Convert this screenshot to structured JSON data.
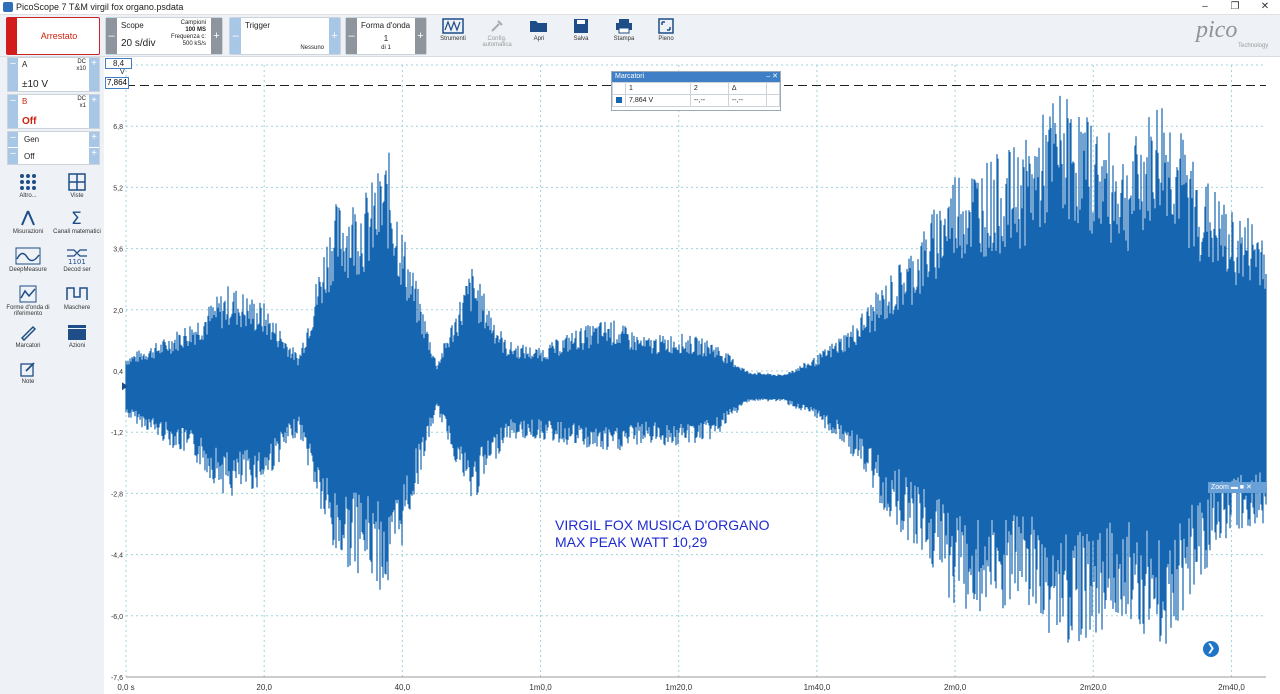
{
  "window": {
    "title": "PicoScope 7 T&M virgil fox organo.psdata"
  },
  "toolbar": {
    "run_status": "Arrestato",
    "scope": {
      "label": "Scope",
      "timebase": "20 s/div",
      "samples_label": "Campioni",
      "samples": "100 MS",
      "freq_label": "Frequenza c:",
      "freq": "500 kS/s"
    },
    "trigger": {
      "label": "Trigger",
      "mode": "Nessuno"
    },
    "waveform": {
      "label": "Forma d'onda",
      "current": "1",
      "of": "di 1"
    },
    "tools": [
      {
        "label": "Strumenti",
        "icon": "instruments-icon"
      },
      {
        "label": "Config. automatica",
        "icon": "auto-setup-icon"
      },
      {
        "label": "Apri",
        "icon": "folder-open-icon"
      },
      {
        "label": "Salva",
        "icon": "save-icon"
      },
      {
        "label": "Stampa",
        "icon": "print-icon"
      },
      {
        "label": "Pieno",
        "icon": "fullscreen-icon"
      }
    ],
    "logo": {
      "word": "pico",
      "sub": "Technology"
    }
  },
  "channels": {
    "a": {
      "name": "A",
      "coupling": "DC",
      "probe": "x10",
      "range": "±10 V"
    },
    "b": {
      "name": "B",
      "coupling": "DC",
      "probe": "x1",
      "range": "Off"
    },
    "gen": {
      "label": "Gen",
      "state": "Off"
    }
  },
  "side_tools": [
    {
      "label": "Altro...",
      "icon": "more-dots-icon"
    },
    {
      "label": "Viste",
      "icon": "views-grid-icon"
    },
    {
      "label": "Misurazioni",
      "icon": "compass-icon"
    },
    {
      "label": "Canali matematici",
      "icon": "sigma-icon"
    },
    {
      "label": "DeepMeasure",
      "icon": "deepmeasure-icon"
    },
    {
      "label": "Decod ser",
      "icon": "serial-decode-icon"
    },
    {
      "label": "Forme d'onda di riferimento",
      "icon": "reference-waveform-icon"
    },
    {
      "label": "Maschere",
      "icon": "masks-icon"
    },
    {
      "label": "Marcatori",
      "icon": "pencil-icon"
    },
    {
      "label": "Azioni",
      "icon": "clapper-icon"
    },
    {
      "label": "Note",
      "icon": "note-icon"
    }
  ],
  "plot": {
    "y_unit": "V",
    "y_ticks": [
      "8,4",
      "6,8",
      "5,2",
      "3,6",
      "2,0",
      "0,4",
      "-1,2",
      "-2,8",
      "-4,4",
      "-6,0",
      "-7,6"
    ],
    "x_ticks": [
      "0,0 s",
      "20,0",
      "40,0",
      "1m0,0",
      "1m20,0",
      "1m40,0",
      "2m0,0",
      "2m20,0",
      "2m40,0"
    ],
    "marker_value": "7,864",
    "markers_window": {
      "title": "Marcatori",
      "headers": [
        "1",
        "2",
        "Δ"
      ],
      "row": [
        "7,864 V",
        "--,--",
        "--,--"
      ]
    },
    "zoom_label": "Zoom",
    "annotation": [
      "VIRGIL FOX MUSICA D'ORGANO",
      "MAX PEAK WATT 10,29"
    ],
    "waveform_color": "#1565b0"
  },
  "chart_data": {
    "type": "line",
    "title": "",
    "xlabel": "",
    "ylabel": "V",
    "xlim": [
      0,
      165
    ],
    "ylim": [
      -7.6,
      8.4
    ],
    "marker_level": 7.864,
    "series": [
      {
        "x": [
          0,
          5,
          10,
          15,
          20,
          25,
          30,
          35,
          38,
          40,
          45,
          50,
          55,
          60,
          65,
          70,
          75,
          80,
          85,
          90,
          95,
          100,
          105,
          110,
          115,
          120,
          125,
          130,
          135,
          140,
          145,
          150,
          155,
          160,
          165
        ],
        "upper": [
          0.8,
          1.2,
          1.8,
          2.7,
          2.2,
          0.8,
          4.8,
          5.2,
          6.2,
          4.2,
          0.6,
          3.2,
          1.2,
          1.0,
          1.5,
          1.8,
          1.3,
          1.4,
          1.2,
          0.4,
          0.3,
          0.8,
          1.6,
          2.8,
          4.0,
          5.8,
          6.0,
          6.4,
          7.8,
          7.0,
          6.2,
          7.8,
          5.8,
          4.6,
          4.4
        ],
        "lower": [
          -0.8,
          -1.4,
          -2.0,
          -3.0,
          -2.6,
          -1.2,
          -4.6,
          -5.0,
          -5.6,
          -4.2,
          -0.6,
          -3.2,
          -1.4,
          -1.4,
          -1.6,
          -1.8,
          -1.5,
          -1.6,
          -1.4,
          -0.4,
          -0.4,
          -0.9,
          -1.8,
          -3.4,
          -4.4,
          -5.8,
          -6.2,
          -5.8,
          -6.8,
          -6.6,
          -6.0,
          -7.0,
          -5.2,
          -3.8,
          -3.8
        ]
      }
    ]
  }
}
